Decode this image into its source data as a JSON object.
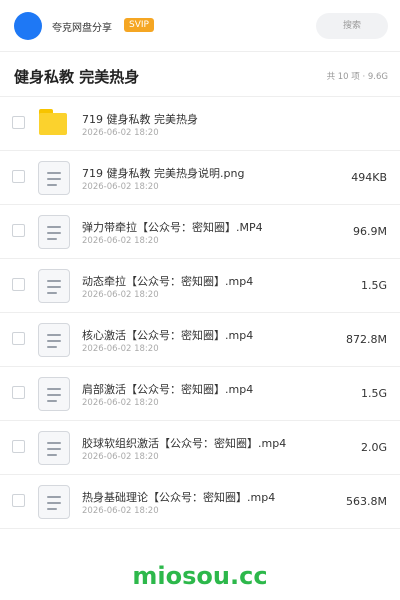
{
  "header": {
    "share_title": "夸克网盘分享",
    "svip_badge": "SVIP",
    "search_placeholder": "搜索"
  },
  "folder": {
    "name": "健身私教 完美热身",
    "meta": "共 10 项 · 9.6G"
  },
  "files": [
    {
      "name": "719 健身私教 完美热身",
      "date": "2026-06-02 18:20",
      "size": "",
      "icon": "folder-icon"
    },
    {
      "name": "719 健身私教 完美热身说明.png",
      "date": "2026-06-02 18:20",
      "size": "494KB",
      "icon": "file-icon"
    },
    {
      "name": "弹力带牵拉【公众号：密知圈】.MP4",
      "date": "2026-06-02 18:20",
      "size": "96.9M",
      "icon": "file-icon"
    },
    {
      "name": "动态牵拉【公众号：密知圈】.mp4",
      "date": "2026-06-02 18:20",
      "size": "1.5G",
      "icon": "file-icon"
    },
    {
      "name": "核心激活【公众号：密知圈】.mp4",
      "date": "2026-06-02 18:20",
      "size": "872.8M",
      "icon": "file-icon"
    },
    {
      "name": "肩部激活【公众号：密知圈】.mp4",
      "date": "2026-06-02 18:20",
      "size": "1.5G",
      "icon": "file-icon"
    },
    {
      "name": "胶球软组织激活【公众号：密知圈】.mp4",
      "date": "2026-06-02 18:20",
      "size": "2.0G",
      "icon": "file-icon"
    },
    {
      "name": "热身基础理论【公众号：密知圈】.mp4",
      "date": "2026-06-02 18:20",
      "size": "563.8M",
      "icon": "file-icon"
    }
  ],
  "watermark": "miosou.cc",
  "colors": {
    "accent": "#1e78f5",
    "svip": "#f5a623",
    "watermark": "#2db84b",
    "folder": "#fbd22d"
  }
}
